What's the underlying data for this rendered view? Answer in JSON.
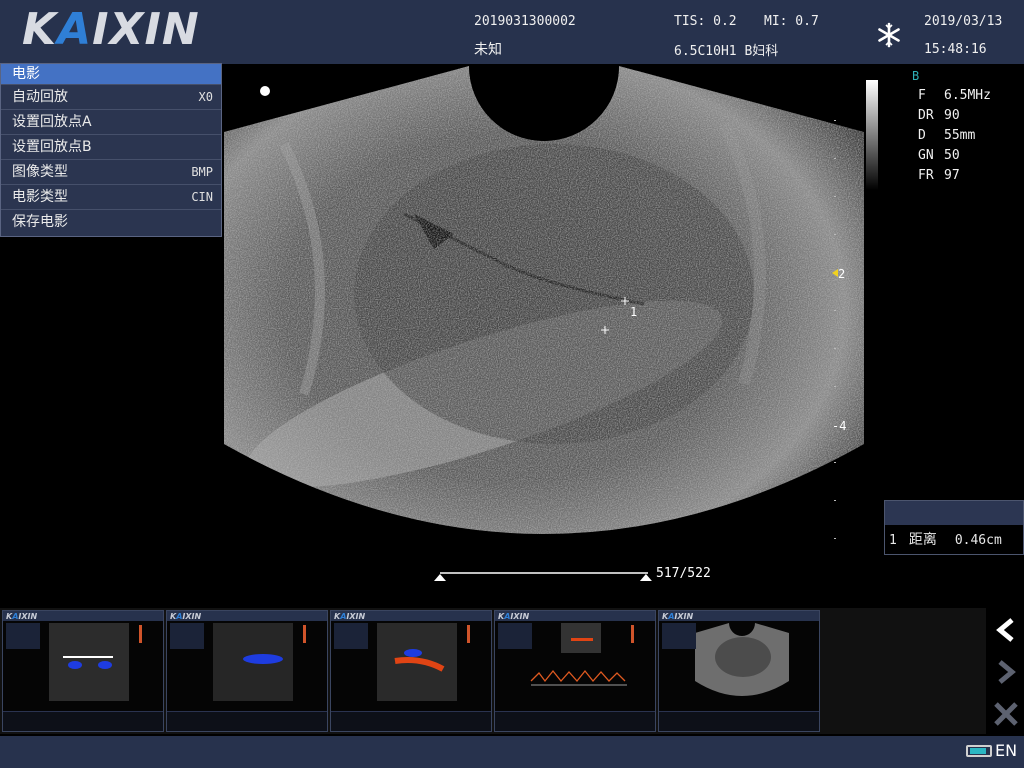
{
  "header": {
    "logo_text_1": "K",
    "logo_text_2": "A",
    "logo_text_3": "IXIN",
    "patient_id": "2019031300002",
    "patient_name": "未知",
    "tis": "TIS: 0.2",
    "mi": "MI: 0.7",
    "probe_exam": "6.5C10H1 B妇科",
    "date": "2019/03/13",
    "time": "15:48:16"
  },
  "menu": {
    "title": "电影",
    "items": [
      {
        "label": "自动回放",
        "value": "X0"
      },
      {
        "label": "设置回放点A",
        "value": ""
      },
      {
        "label": "设置回放点B",
        "value": ""
      },
      {
        "label": "图像类型",
        "value": "BMP"
      },
      {
        "label": "电影类型",
        "value": "CIN"
      },
      {
        "label": "保存电影",
        "value": ""
      }
    ]
  },
  "params": {
    "mode": "B",
    "rows": [
      {
        "k": "F",
        "v": "6.5MHz"
      },
      {
        "k": "DR",
        "v": "90"
      },
      {
        "k": "D",
        "v": "55mm"
      },
      {
        "k": "GN",
        "v": "50"
      },
      {
        "k": "FR",
        "v": "97"
      }
    ]
  },
  "depth": {
    "focus_label": "2",
    "mark_label": "-4"
  },
  "caliper": {
    "label": "1"
  },
  "cine": {
    "frame": "517/522",
    "position_fraction": 0.99
  },
  "measurement": {
    "index": "1",
    "label": "距离",
    "value": "0.46cm"
  },
  "thumbnails": {
    "logo_1": "K",
    "logo_2": "A",
    "logo_3": "IXIN"
  },
  "status": {
    "language": "EN"
  },
  "icons": {
    "freeze": "snowflake-icon",
    "prev": "chevron-left-icon",
    "next": "chevron-right-icon",
    "delete": "close-icon",
    "battery": "battery-icon"
  }
}
